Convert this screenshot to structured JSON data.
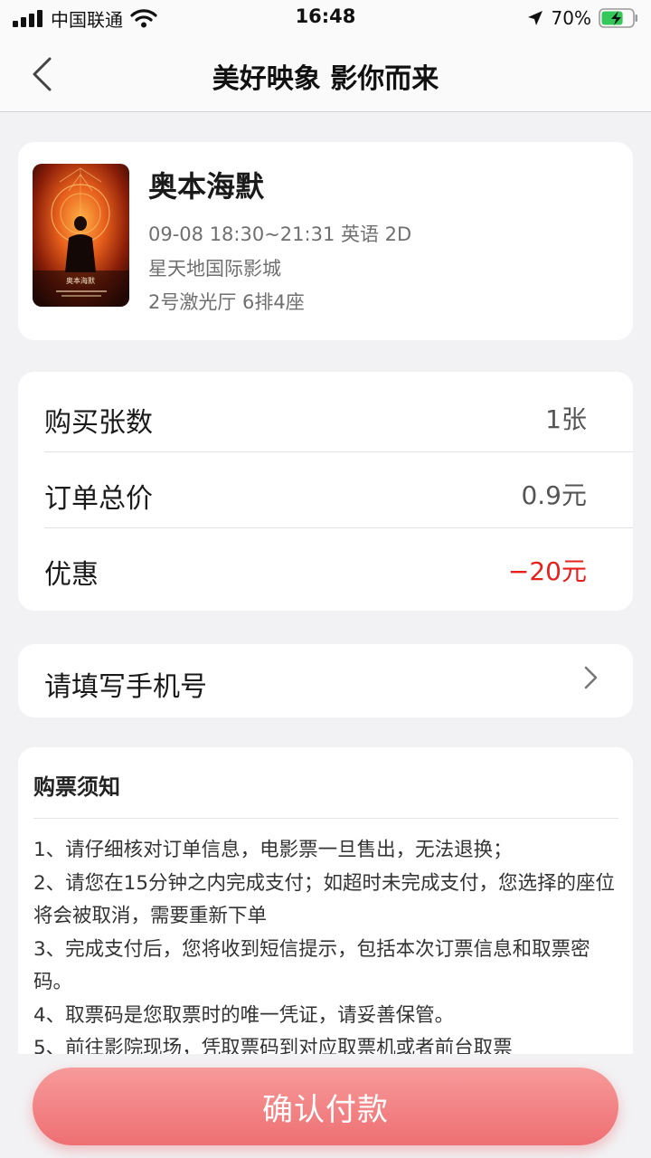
{
  "status_bar": {
    "carrier": "中国联通",
    "time": "16:48",
    "battery_percent": "70%",
    "battery_level": 0.7,
    "icons": [
      "signal-icon",
      "wifi-icon",
      "location-icon",
      "battery-charging-icon"
    ]
  },
  "nav": {
    "title": "美好映象 影你而来",
    "back_icon": "chevron-left-icon"
  },
  "movie": {
    "title": "奥本海默",
    "schedule": "09-08 18:30~21:31 英语 2D",
    "cinema": "星天地国际影城",
    "seat": "2号激光厅 6排4座",
    "poster_text": "奥本海默"
  },
  "order": {
    "rows": [
      {
        "label": "购买张数",
        "value": "1张"
      },
      {
        "label": "订单总价",
        "value": "0.9元"
      },
      {
        "label": "优惠",
        "value": "−20元"
      }
    ]
  },
  "phone": {
    "label": "请填写手机号",
    "chevron_icon": "chevron-right-icon"
  },
  "notice": {
    "title": "购票须知",
    "items": [
      "1、请仔细核对订单信息，电影票一旦售出，无法退换；",
      "2、请您在15分钟之内完成支付；如超时未完成支付，您选择的座位将会被取消，需要重新下单",
      "3、完成支付后，您将收到短信提示，包括本次订票信息和取票密码。",
      "4、取票码是您取票时的唯一凭证，请妥善保管。",
      "5、前往影院现场，凭取票码到对应取票机或者前台取票"
    ]
  },
  "colors": {
    "discount_red": "#e6201e",
    "pay_button": "#ee6f72",
    "background": "#f2f2f4"
  },
  "pay_button": {
    "label": "确认付款"
  }
}
